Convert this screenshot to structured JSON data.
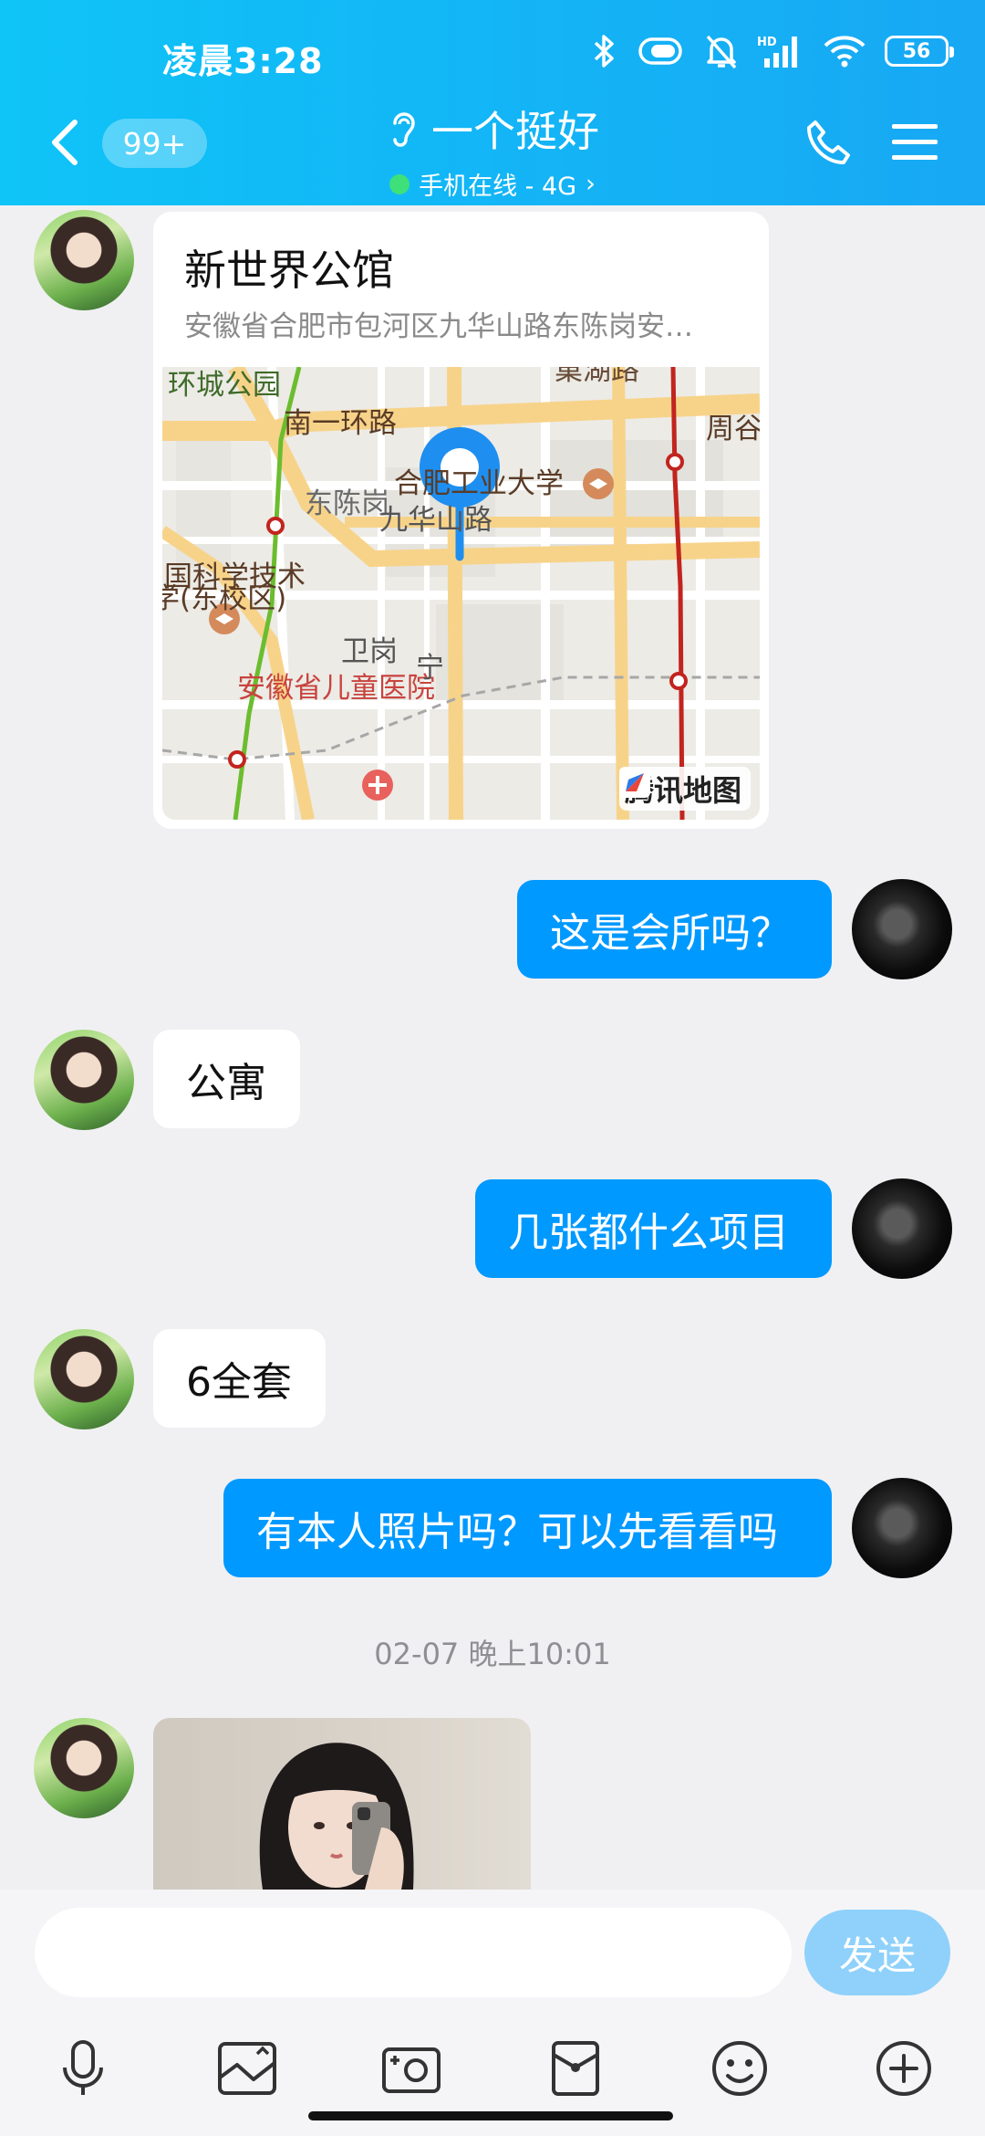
{
  "status_bar": {
    "time": "凌晨3:28",
    "battery": "56",
    "network_label": "HD"
  },
  "header": {
    "unread_badge": "99+",
    "contact_name": "一个挺好",
    "online_status": "手机在线 - 4G",
    "online_chevron": "›",
    "online_color": "#3ee07a"
  },
  "messages": {
    "location": {
      "name": "新世界公馆",
      "address": "安徽省合肥市包河区九华山路东陈岗安…",
      "map_labels": {
        "ring_park": "环城公园",
        "south_ring": "南一环路",
        "zhougu": "周谷",
        "hfut": "合肥工业大学",
        "dongchen": "东陈岗",
        "jiuhua": "九华山路",
        "ustc1": "国科学技术",
        "ustc2": "学(东校区)",
        "weigang": "卫岗",
        "top_road": "巢湖路",
        "bottom_hospital": "安徽省儿童医院",
        "ning": "宁"
      },
      "map_provider": "腾讯地图"
    },
    "m1": "这是会所吗？",
    "m2": "公寓",
    "m3": "几张都什么项目",
    "m4": "6全套",
    "m5": "有本人照片吗？可以先看看吗",
    "timestamp": "02-07 晚上10:01"
  },
  "input": {
    "placeholder": "",
    "send_label": "发送"
  },
  "colors": {
    "header_gradient_start": "#0fc4f7",
    "header_gradient_end": "#18a8f4",
    "outgoing_bubble": "#0099ff",
    "send_button": "#8fd1fb"
  },
  "icons": {
    "back": "chevron-left-icon",
    "ear": "ear-icon",
    "phone": "phone-icon",
    "menu": "menu-icon",
    "voice": "microphone-icon",
    "gallery": "image-icon",
    "camera": "camera-icon",
    "red_packet": "red-packet-icon",
    "emoji": "emoji-icon",
    "plus": "plus-circle-icon"
  }
}
